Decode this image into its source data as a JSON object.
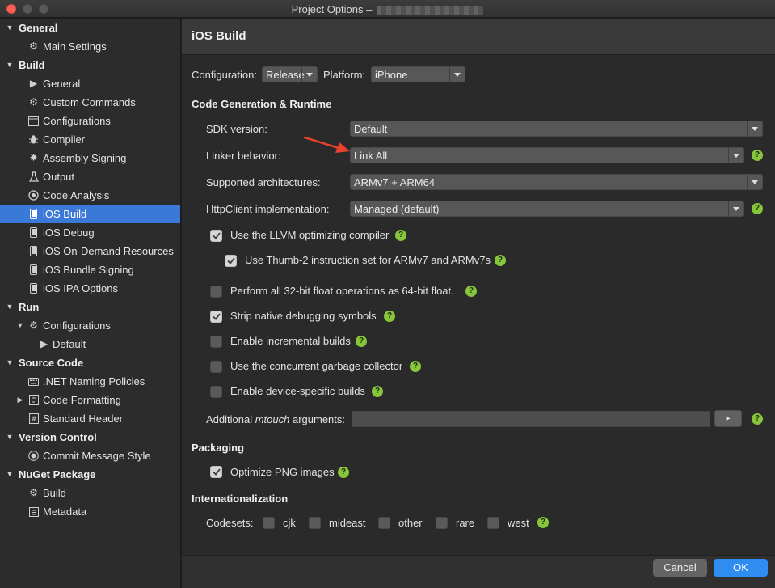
{
  "window": {
    "title": "Project Options –"
  },
  "sidebar": {
    "items": [
      {
        "label": "General",
        "kind": "section",
        "expanded": true
      },
      {
        "label": "Main Settings",
        "icon": "gear-icon"
      },
      {
        "label": "Build",
        "kind": "section",
        "expanded": true
      },
      {
        "label": "General",
        "icon": "play-icon"
      },
      {
        "label": "Custom Commands",
        "icon": "gear-icon"
      },
      {
        "label": "Configurations",
        "icon": "window-icon"
      },
      {
        "label": "Compiler",
        "icon": "bug-icon"
      },
      {
        "label": "Assembly Signing",
        "icon": "seal-icon"
      },
      {
        "label": "Output",
        "icon": "flask-icon"
      },
      {
        "label": "Code Analysis",
        "icon": "target-icon"
      },
      {
        "label": "iOS Build",
        "icon": "phone-icon",
        "selected": true
      },
      {
        "label": "iOS Debug",
        "icon": "phone-icon"
      },
      {
        "label": "iOS On-Demand Resources",
        "icon": "phone-icon"
      },
      {
        "label": "iOS Bundle Signing",
        "icon": "phone-icon"
      },
      {
        "label": "iOS IPA Options",
        "icon": "phone-icon"
      },
      {
        "label": "Run",
        "kind": "section",
        "expanded": true
      },
      {
        "label": "Configurations",
        "icon": "gear-icon",
        "expanded": true
      },
      {
        "label": "Default",
        "icon": "play-icon"
      },
      {
        "label": "Source Code",
        "kind": "section",
        "expanded": true
      },
      {
        "label": ".NET Naming Policies",
        "icon": "keyboard-icon"
      },
      {
        "label": "Code Formatting",
        "icon": "document-icon",
        "collapsed": true
      },
      {
        "label": "Standard Header",
        "icon": "hash-icon"
      },
      {
        "label": "Version Control",
        "kind": "section",
        "expanded": true
      },
      {
        "label": "Commit Message Style",
        "icon": "commit-icon"
      },
      {
        "label": "NuGet Package",
        "kind": "section",
        "expanded": true
      },
      {
        "label": "Build",
        "icon": "gear-icon"
      },
      {
        "label": "Metadata",
        "icon": "list-icon"
      }
    ]
  },
  "main": {
    "title": "iOS Build",
    "configuration_label": "Configuration:",
    "configuration_value": "Release",
    "platform_label": "Platform:",
    "platform_value": "iPhone",
    "codegen": {
      "title": "Code Generation & Runtime",
      "sdk_version_label": "SDK version:",
      "sdk_version_value": "Default",
      "linker_label": "Linker behavior:",
      "linker_value": "Link All",
      "arch_label": "Supported architectures:",
      "arch_value": "ARMv7 + ARM64",
      "httpclient_label": "HttpClient implementation:",
      "httpclient_value": "Managed (default)",
      "options": [
        {
          "label": "Use the LLVM optimizing compiler",
          "checked": true
        },
        {
          "label": "Use Thumb-2 instruction set for ARMv7 and ARMv7s",
          "checked": true
        },
        {
          "label": "Perform all 32-bit float operations as 64-bit float.",
          "checked": false
        },
        {
          "label": "Strip native debugging symbols",
          "checked": true
        },
        {
          "label": "Enable incremental builds",
          "checked": false
        },
        {
          "label": "Use the concurrent garbage collector",
          "checked": false
        },
        {
          "label": "Enable device-specific builds",
          "checked": false
        }
      ],
      "mtouch_label_pre": "Additional ",
      "mtouch_label_em": "mtouch",
      "mtouch_label_post": " arguments:",
      "mtouch_value": "",
      "mtouch_button": "▸"
    },
    "packaging": {
      "title": "Packaging",
      "optimize_png_label": "Optimize PNG images",
      "optimize_png_checked": true
    },
    "i18n": {
      "title": "Internationalization",
      "codesets_label": "Codesets:",
      "codesets": [
        {
          "label": "cjk",
          "checked": false
        },
        {
          "label": "mideast",
          "checked": false
        },
        {
          "label": "other",
          "checked": false
        },
        {
          "label": "rare",
          "checked": false
        },
        {
          "label": "west",
          "checked": false
        }
      ]
    },
    "help_glyph": "?"
  },
  "footer": {
    "cancel_label": "Cancel",
    "ok_label": "OK"
  },
  "colors": {
    "selection": "#3b79d9",
    "help": "#87c63b",
    "ok_button": "#2f8cf0",
    "annotation_arrow": "#e8412e"
  }
}
